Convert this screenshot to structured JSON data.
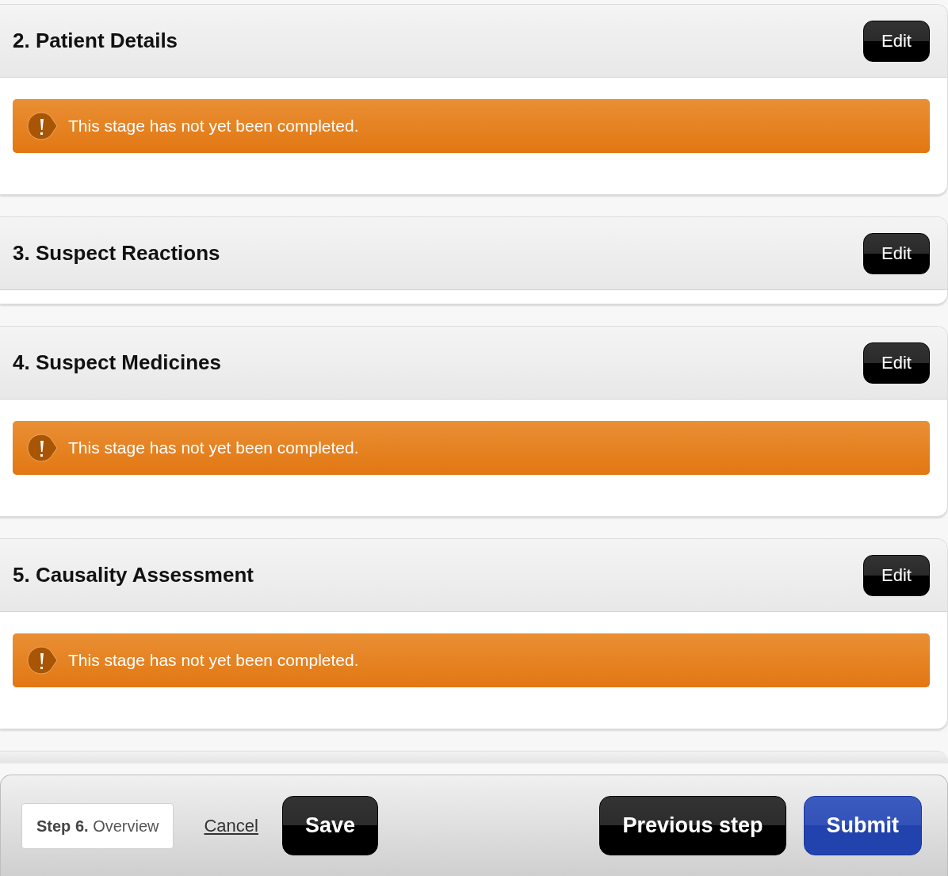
{
  "sections": [
    {
      "title": "2. Patient Details",
      "edit_label": "Edit",
      "message": "This stage has not yet been completed."
    },
    {
      "title": "3. Suspect Reactions",
      "edit_label": "Edit"
    },
    {
      "title": "4. Suspect Medicines",
      "edit_label": "Edit",
      "message": "This stage has not yet been completed."
    },
    {
      "title": "5. Causality Assessment",
      "edit_label": "Edit",
      "message": "This stage has not yet been completed."
    }
  ],
  "footer": {
    "step": "**Step 6.** Overview",
    "link": "Cancel",
    "buttons": [
      {
        "label": "Save",
        "kind": "dark"
      },
      {
        "label": "Previous step",
        "kind": "dark"
      },
      {
        "label": "Submit",
        "kind": "primary"
      }
    ]
  }
}
